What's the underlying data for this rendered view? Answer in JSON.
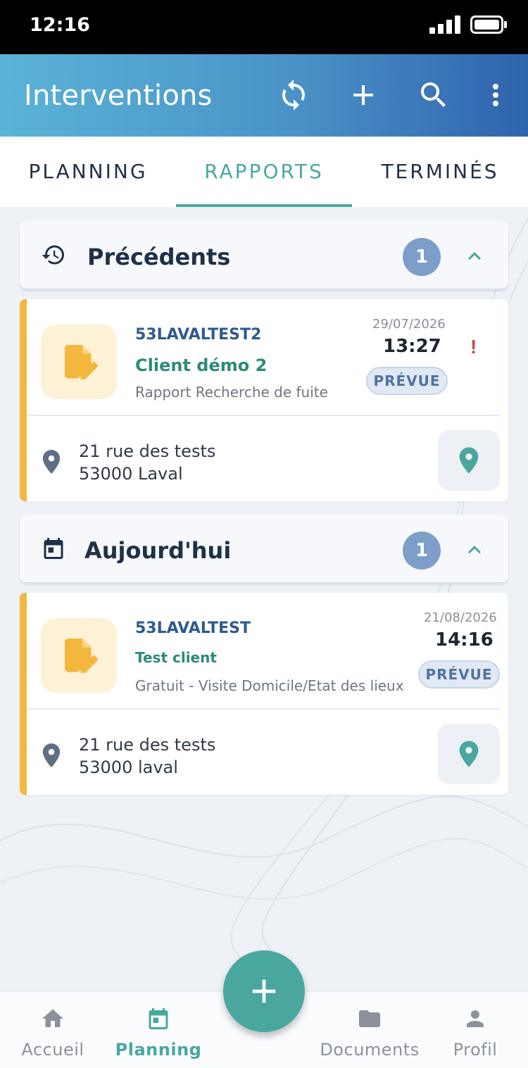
{
  "status_bar": {
    "time": "12:16"
  },
  "app_bar": {
    "title": "Interventions"
  },
  "tabs": [
    {
      "label": "PLANNING",
      "active": false
    },
    {
      "label": "RAPPORTS",
      "active": true
    },
    {
      "label": "TERMINÉS",
      "active": false
    }
  ],
  "sections": [
    {
      "title": "Précédents",
      "count": "1",
      "icon": "history-icon",
      "card": {
        "reference": "53LAVALTEST2",
        "client": "Client démo 2",
        "description": "Rapport Recherche de fuite",
        "date": "29/07/2026",
        "time": "13:27",
        "status": "PRÉVUE",
        "alert": "!",
        "address_line1": "21 rue des tests",
        "address_line2": "53000 Laval"
      }
    },
    {
      "title": "Aujourd'hui",
      "count": "1",
      "icon": "calendar-icon",
      "card": {
        "reference": "53LAVALTEST",
        "client": "Test client",
        "description": "Gratuit - Visite Domicile/Etat des lieux",
        "date": "21/08/2026",
        "time": "14:16",
        "status": "PRÉVUE",
        "address_line1": "21 rue des tests",
        "address_line2": "53000 laval"
      }
    }
  ],
  "bottom_nav": [
    {
      "label": "Accueil",
      "icon": "home-icon",
      "active": false
    },
    {
      "label": "Planning",
      "icon": "calendar-icon",
      "active": true
    },
    {
      "label": "Documents",
      "icon": "folder-icon",
      "active": false
    },
    {
      "label": "Profil",
      "icon": "person-icon",
      "active": false
    }
  ],
  "colors": {
    "accent_teal": "#4aa7a0",
    "card_accent": "#f2b73c",
    "badge_blue": "#7d9ec9",
    "header_gradient_start": "#5ab3d6",
    "header_gradient_end": "#2f63ad"
  }
}
